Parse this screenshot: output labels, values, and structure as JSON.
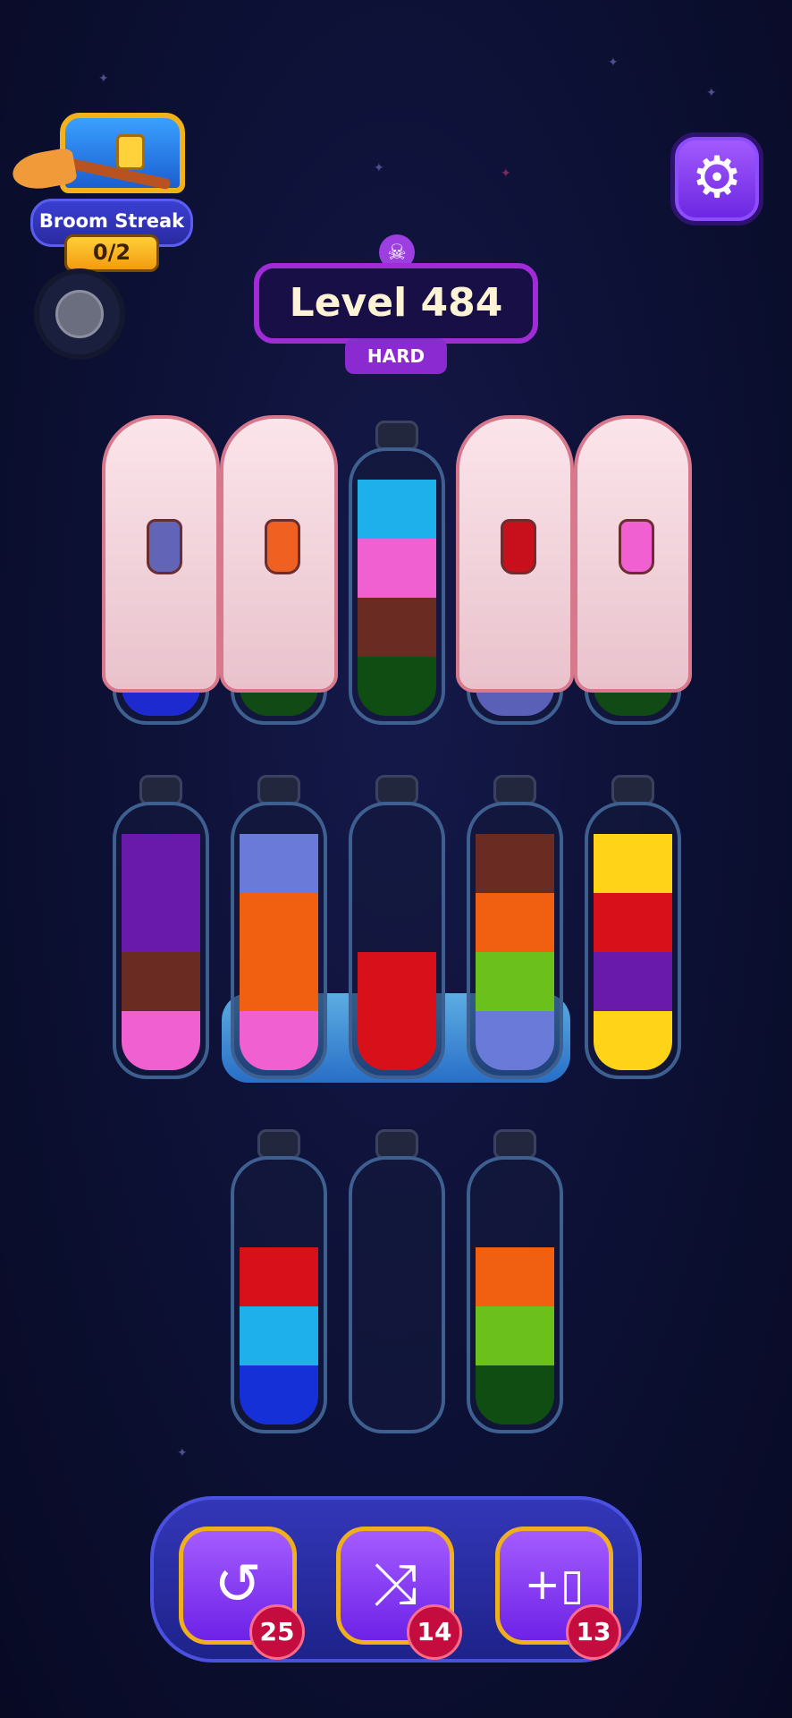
{
  "streak": {
    "label": "Broom Streak",
    "count": "0/2"
  },
  "level": {
    "title": "Level 484",
    "difficulty": "HARD"
  },
  "powerups": [
    {
      "name": "undo",
      "icon": "↺",
      "count": "25"
    },
    {
      "name": "shuffle",
      "icon": "⤨",
      "count": "14"
    },
    {
      "name": "add-bottle",
      "icon": "+▯",
      "count": "13"
    }
  ],
  "colors": {
    "red": "#d8101a",
    "blue": "#1530d6",
    "cyan": "#1db0ea",
    "pink": "#f060d0",
    "brown": "#6a2c22",
    "darkgreen": "#0f4d12",
    "orange": "#f06010",
    "green": "#6cc01c",
    "purple": "#6a1aaa",
    "yellow": "#ffd418",
    "lavender": "#6a7ad8"
  },
  "rows": [
    {
      "bottles": [
        {
          "hidden": true,
          "hint": "#6264b8",
          "base": "#1c2ad0"
        },
        {
          "hidden": true,
          "hint": "#f06020",
          "base": "#124a16"
        },
        {
          "hidden": false,
          "layers": [
            "darkgreen",
            "brown",
            "pink",
            "cyan"
          ]
        },
        {
          "hidden": true,
          "hint": "#c8101c",
          "base": "#5a60b8"
        },
        {
          "hidden": true,
          "hint": "#f060d0",
          "base": "#124a16"
        }
      ]
    },
    {
      "bottles": [
        {
          "hidden": false,
          "layers": [
            "pink",
            "brown",
            "purple",
            "purple"
          ]
        },
        {
          "hidden": false,
          "frozen": true,
          "layers": [
            "pink",
            "orange",
            "orange",
            "lavender"
          ]
        },
        {
          "hidden": false,
          "frozen": true,
          "layers": [
            "red",
            "red"
          ]
        },
        {
          "hidden": false,
          "frozen": true,
          "layers": [
            "lavender",
            "green",
            "orange",
            "brown"
          ]
        },
        {
          "hidden": false,
          "layers": [
            "yellow",
            "purple",
            "red",
            "yellow"
          ]
        }
      ]
    },
    {
      "bottles": [
        {
          "hidden": false,
          "layers": [
            "blue",
            "cyan",
            "red"
          ]
        },
        {
          "hidden": false,
          "layers": []
        },
        {
          "hidden": false,
          "layers": [
            "darkgreen",
            "green",
            "orange"
          ]
        }
      ]
    }
  ]
}
